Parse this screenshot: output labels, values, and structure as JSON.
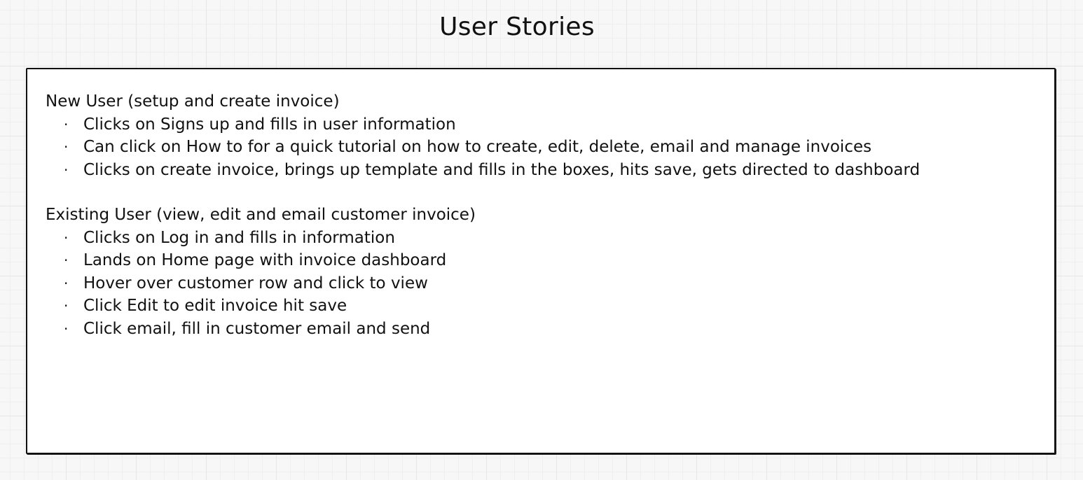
{
  "title": "User Stories",
  "sections": [
    {
      "heading": "New User (setup and create invoice)",
      "items": [
        "Clicks on Signs up and fills in user information",
        "Can click on How to for a quick tutorial on how to create, edit, delete, email and manage invoices",
        "Clicks on create invoice, brings up template and fills in the boxes, hits save, gets directed to dashboard"
      ]
    },
    {
      "heading": "Existing User (view, edit and email customer invoice)",
      "items": [
        "Clicks on Log in and fills in information",
        "Lands on Home page with invoice dashboard",
        "Hover over customer row and click to view",
        "Click Edit to edit invoice hit save",
        "Click email, fill in customer email and send"
      ]
    }
  ],
  "bullet_glyph": "·"
}
